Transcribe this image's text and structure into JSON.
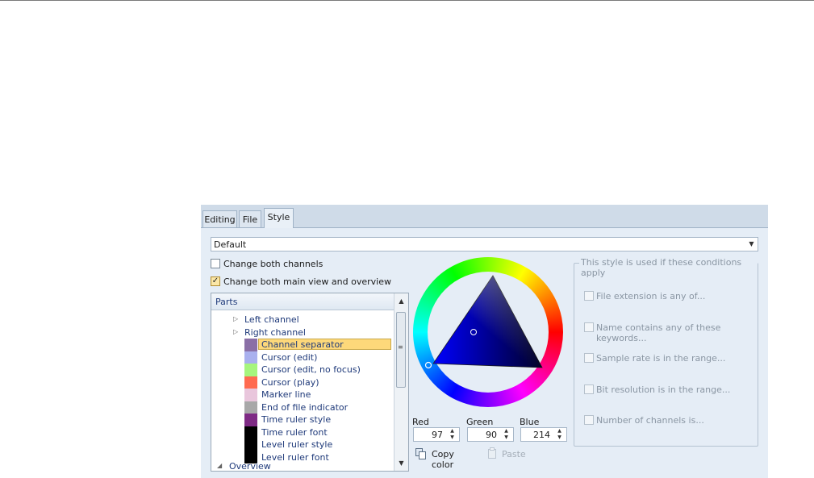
{
  "tabs": [
    {
      "label": "Editing",
      "active": false
    },
    {
      "label": "File",
      "active": false
    },
    {
      "label": "Style",
      "active": true
    }
  ],
  "style_preset": {
    "value": "Default"
  },
  "options": {
    "change_both_channels": {
      "label": "Change both channels",
      "checked": false
    },
    "change_both_views": {
      "label": "Change both main view and overview",
      "checked": true
    }
  },
  "parts": {
    "header": "Parts",
    "items": [
      {
        "label": "Left channel",
        "type": "group",
        "collapsed": true
      },
      {
        "label": "Right channel",
        "type": "group",
        "collapsed": true
      },
      {
        "label": "Channel separator",
        "color": "#8a6fa6",
        "selected": true
      },
      {
        "label": "Cursor (edit)",
        "color": "#a9b0ee"
      },
      {
        "label": "Cursor (edit, no focus)",
        "color": "#a6f57d"
      },
      {
        "label": "Cursor (play)",
        "color": "#ff6a50"
      },
      {
        "label": "Marker line",
        "color": "#e9c6dc"
      },
      {
        "label": "End of file indicator",
        "color": "#a8a8a8"
      },
      {
        "label": "Time ruler style",
        "color": "#7e2a84"
      },
      {
        "label": "Time ruler font",
        "color": "#000000"
      },
      {
        "label": "Level ruler style",
        "color": "#000000"
      },
      {
        "label": "Level ruler font",
        "color": "#000000"
      }
    ],
    "overview": {
      "label": "Overview",
      "expanded": true
    }
  },
  "color": {
    "red_label": "Red",
    "red": "97",
    "green_label": "Green",
    "green": "90",
    "blue_label": "Blue",
    "blue": "214",
    "current_hex": "#615ad6"
  },
  "clipboard": {
    "copy_label": "Copy color",
    "paste_label": "Paste"
  },
  "conditions": {
    "title": "This style is used if these conditions apply",
    "items": [
      {
        "label": "File extension is any of..."
      },
      {
        "label": "Name contains any of these keywords..."
      },
      {
        "label": "Sample rate is in the range..."
      },
      {
        "label": "Bit resolution is in the range..."
      },
      {
        "label": "Number of channels is..."
      }
    ]
  }
}
